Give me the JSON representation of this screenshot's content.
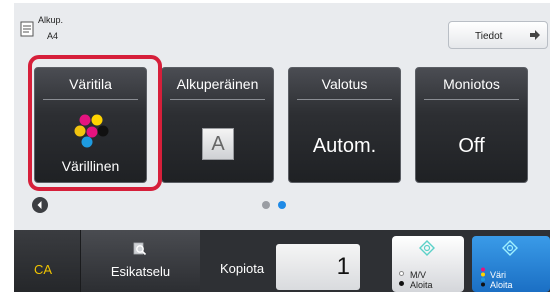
{
  "original": {
    "label": "Alkup.",
    "value": "A4"
  },
  "info_button": {
    "label": "Tiedot"
  },
  "tiles": [
    {
      "title": "Väritila",
      "value": "Värillinen",
      "selected": true
    },
    {
      "title": "Alkuperäinen",
      "value": "A"
    },
    {
      "title": "Valotus",
      "value": "Autom."
    },
    {
      "title": "Moniotos",
      "value": "Off"
    }
  ],
  "page_indicator": {
    "current": 2,
    "total": 2
  },
  "bottom_bar": {
    "ca_label": "CA",
    "preview_label": "Esikatselu",
    "copies_label": "Kopiota",
    "copies_value": "1",
    "bw_start": {
      "mode": "M/V",
      "action": "Aloita"
    },
    "color_start": {
      "mode": "Väri",
      "action": "Aloita"
    }
  },
  "colors": {
    "selection": "#d61f3a",
    "ca_text": "#f0c400",
    "color_start": "#2585d8",
    "active_dot": "#1f8ae6",
    "inactive_dot": "#9a9da3"
  },
  "icons": [
    "original-doc-icon",
    "arrow-right-icon",
    "color-dots-icon",
    "magnifier-icon",
    "start-diamond-icon",
    "chevron-left-icon"
  ]
}
